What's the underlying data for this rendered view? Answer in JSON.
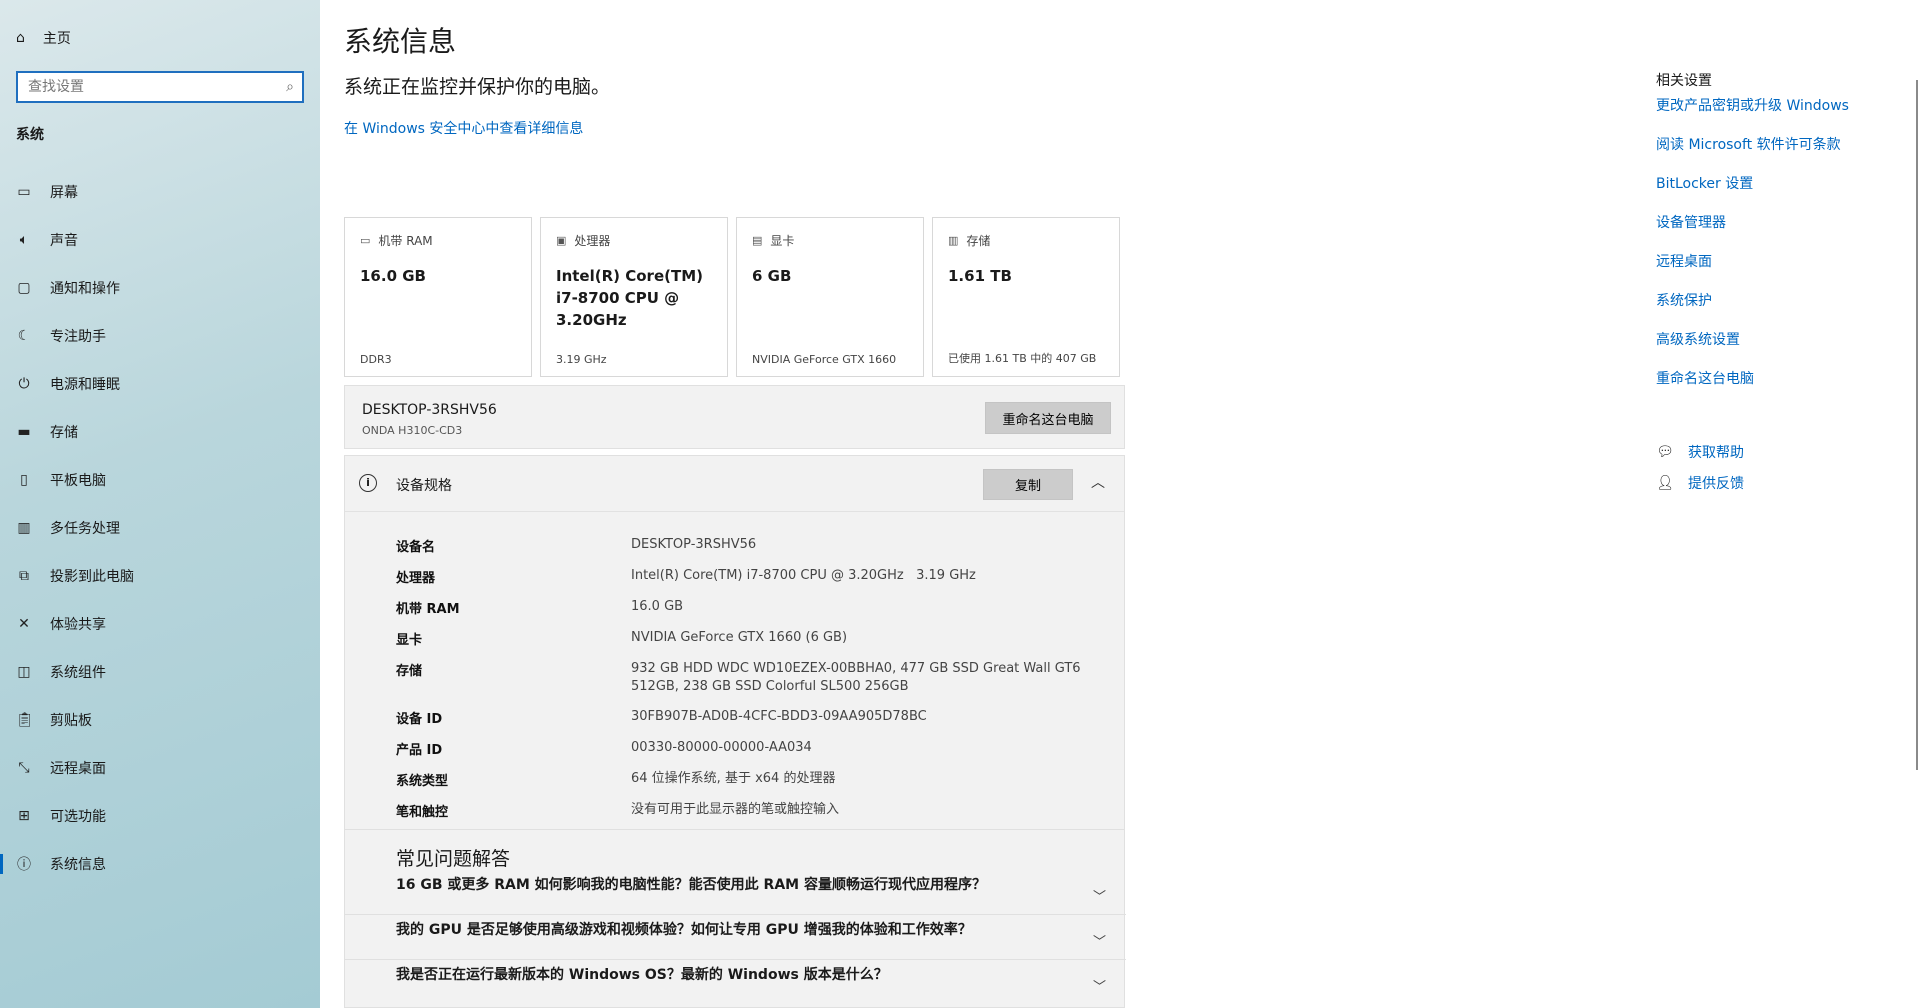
{
  "sidebar": {
    "home_label": "主页",
    "search_placeholder": "查找设置",
    "section_title": "系统",
    "items": [
      {
        "label": "屏幕",
        "icon": "monitor-icon"
      },
      {
        "label": "声音",
        "icon": "speaker-icon"
      },
      {
        "label": "通知和操作",
        "icon": "message-icon"
      },
      {
        "label": "专注助手",
        "icon": "moon-icon"
      },
      {
        "label": "电源和睡眠",
        "icon": "power-icon"
      },
      {
        "label": "存储",
        "icon": "storage-icon"
      },
      {
        "label": "平板电脑",
        "icon": "tablet-icon"
      },
      {
        "label": "多任务处理",
        "icon": "multitask-icon"
      },
      {
        "label": "投影到此电脑",
        "icon": "project-icon"
      },
      {
        "label": "体验共享",
        "icon": "share-icon"
      },
      {
        "label": "系统组件",
        "icon": "components-icon"
      },
      {
        "label": "剪贴板",
        "icon": "clipboard-icon"
      },
      {
        "label": "远程桌面",
        "icon": "remote-icon"
      },
      {
        "label": "可选功能",
        "icon": "features-icon"
      },
      {
        "label": "系统信息",
        "icon": "info-icon"
      }
    ]
  },
  "main": {
    "title": "系统信息",
    "subtitle": "系统正在监控并保护你的电脑。",
    "security_link": "在 Windows 安全中心中查看详细信息",
    "cards": [
      {
        "label": "机带 RAM",
        "value": "16.0 GB",
        "foot": "DDR3"
      },
      {
        "label": "处理器",
        "value": "Intel(R) Core(TM) i7-8700 CPU @ 3.20GHz",
        "foot": "3.19 GHz"
      },
      {
        "label": "显卡",
        "value": "6 GB",
        "foot": "NVIDIA GeForce GTX 1660"
      },
      {
        "label": "存储",
        "value": "1.61 TB",
        "foot": "已使用 1.61 TB 中的 407 GB"
      }
    ],
    "pc": {
      "name": "DESKTOP-3RSHV56",
      "model": "ONDA H310C-CD3",
      "rename_label": "重命名这台电脑"
    },
    "specs": {
      "title": "设备规格",
      "copy_label": "复制",
      "rows": [
        {
          "key": "设备名",
          "value": "DESKTOP-3RSHV56"
        },
        {
          "key": "处理器",
          "value": "Intel(R) Core(TM) i7-8700 CPU @ 3.20GHz   3.19 GHz"
        },
        {
          "key": "机带 RAM",
          "value": "16.0 GB"
        },
        {
          "key": "显卡",
          "value": "NVIDIA GeForce GTX 1660 (6 GB)"
        },
        {
          "key": "存储",
          "value": "932 GB HDD WDC WD10EZEX-00BBHA0, 477 GB SSD Great Wall GT6 512GB, 238 GB SSD Colorful SL500 256GB"
        },
        {
          "key": "设备 ID",
          "value": "30FB907B-AD0B-4CFC-BDD3-09AA905D78BC"
        },
        {
          "key": "产品 ID",
          "value": "00330-80000-00000-AA034"
        },
        {
          "key": "系统类型",
          "value": "64 位操作系统, 基于 x64 的处理器"
        },
        {
          "key": "笔和触控",
          "value": "没有可用于此显示器的笔或触控输入"
        }
      ]
    },
    "faq": {
      "title": "常见问题解答",
      "items": [
        "16 GB 或更多 RAM 如何影响我的电脑性能？能否使用此 RAM 容量顺畅运行现代应用程序？",
        "我的 GPU 是否足够使用高级游戏和视频体验？如何让专用 GPU 增强我的体验和工作效率？",
        "我是否正在运行最新版本的 Windows OS？最新的 Windows 版本是什么？"
      ]
    }
  },
  "related": {
    "title": "相关设置",
    "links": [
      "更改产品密钥或升级 Windows",
      "阅读 Microsoft 软件许可条款",
      "BitLocker 设置",
      "设备管理器",
      "远程桌面",
      "系统保护",
      "高级系统设置",
      "重命名这台电脑"
    ],
    "help": [
      {
        "label": "获取帮助",
        "icon": "help-chat-icon"
      },
      {
        "label": "提供反馈",
        "icon": "feedback-icon"
      }
    ]
  },
  "colors": {
    "accent": "#0067c0",
    "panel": "#f2f2f2"
  }
}
